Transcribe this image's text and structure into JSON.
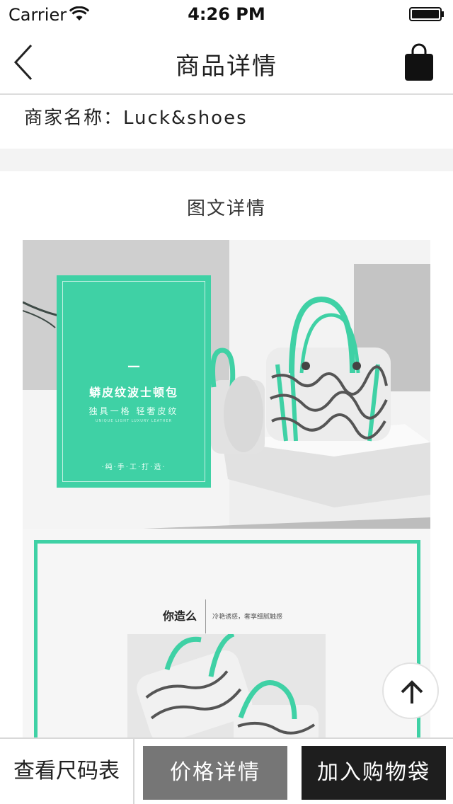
{
  "status_bar": {
    "carrier": "Carrier",
    "time": "4:26 PM",
    "wifi_icon": "wifi-icon",
    "battery_icon": "battery-icon"
  },
  "nav": {
    "title": "商品详情",
    "back_icon": "chevron-left-icon",
    "bag_icon": "shopping-bag-icon"
  },
  "merchant": {
    "label": "商家名称：",
    "name": "Luck&shoes"
  },
  "section": {
    "title": "图文详情"
  },
  "product_image": {
    "card_dash": "—",
    "card_title": "蟒皮纹波士顿包",
    "card_subtitle": "独具一格 轻奢皮纹",
    "card_subtitle_en": "UNIQUE LIGHT LUXURY LEATHER",
    "card_footer": "·纯·手·工·打·造·",
    "slogan_title": "你造么",
    "slogan_text": "冷艳诱惑，奢享细腻触感",
    "accent_color": "#3fd1a5"
  },
  "scroll_top": {
    "icon": "arrow-up-icon"
  },
  "bottom_bar": {
    "size_chart_label": "查看尺码表",
    "price_detail_label": "价格详情",
    "add_to_bag_label": "加入购物袋"
  }
}
